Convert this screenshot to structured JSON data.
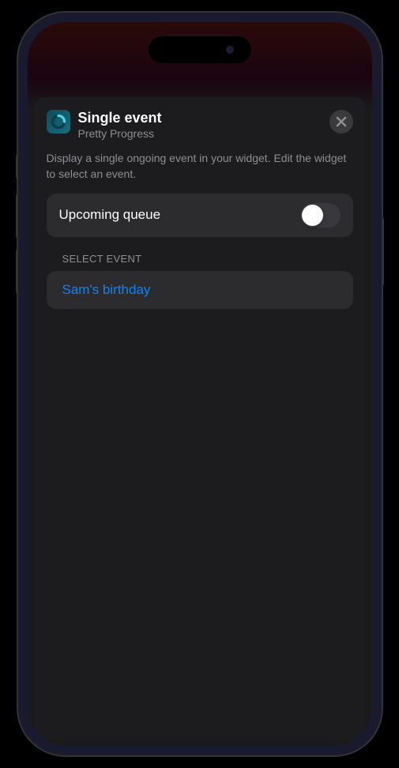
{
  "sheet": {
    "title": "Single event",
    "subtitle": "Pretty Progress",
    "description": "Display a single ongoing event in your widget. Edit the widget to select an event."
  },
  "toggle": {
    "label": "Upcoming queue",
    "enabled": false
  },
  "section": {
    "label": "SELECT EVENT"
  },
  "event": {
    "name": "Sam's birthday"
  }
}
